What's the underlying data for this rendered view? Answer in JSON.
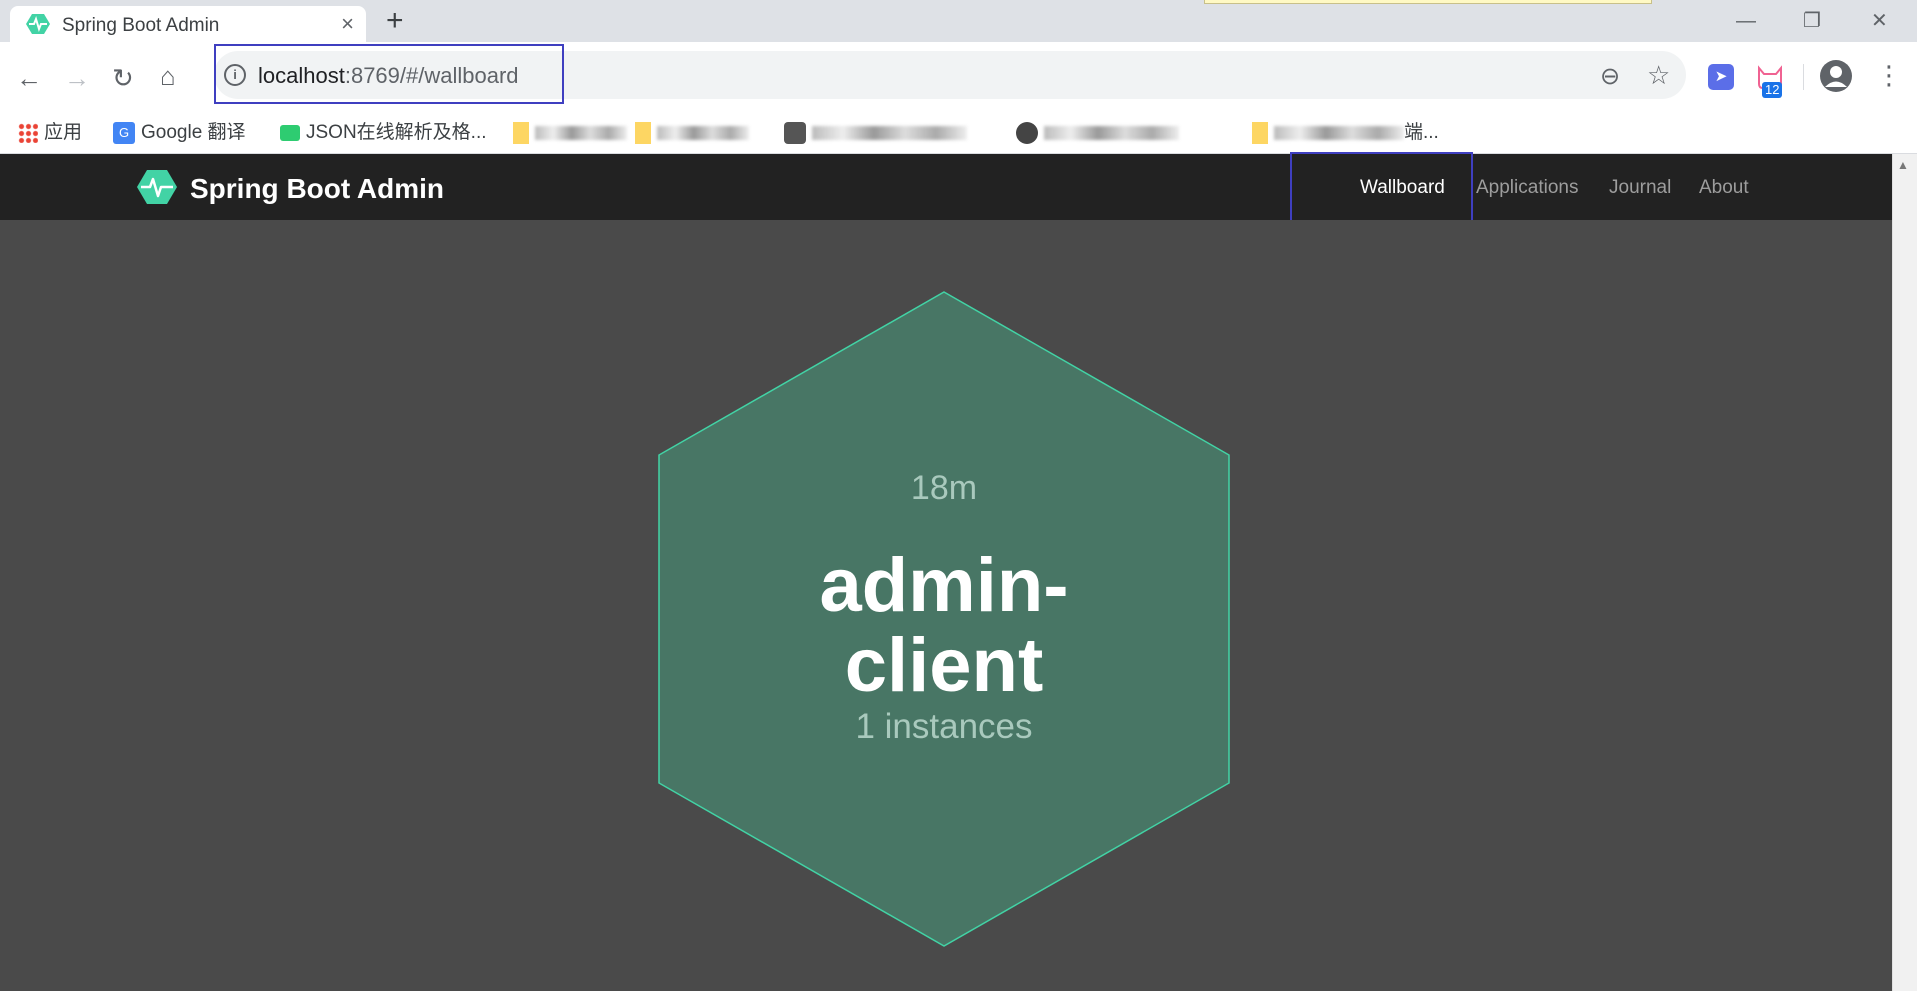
{
  "browser": {
    "tab": {
      "title": "Spring Boot Admin",
      "favicon": "spring-boot-admin-heart-icon"
    },
    "new_tab_label": "+",
    "window_controls": {
      "minimize": "—",
      "restore": "❐",
      "close": "✕"
    },
    "address": {
      "host": "localhost",
      "rest": ":8769/#/wallboard"
    },
    "extension_badge": "12",
    "bookmarks": [
      {
        "label": "应用",
        "icon": "apps-grid-icon"
      },
      {
        "label": "Google 翻译",
        "icon": "google-translate-icon"
      },
      {
        "label": "JSON在线解析及格...",
        "icon": "json-icon"
      },
      {
        "label": "",
        "icon": "folder-icon"
      },
      {
        "label": "",
        "icon": "folder-icon"
      },
      {
        "label": "",
        "icon": "site-icon"
      },
      {
        "label": "",
        "icon": "site-icon"
      },
      {
        "label": "端...",
        "icon": "folder-icon"
      }
    ],
    "colors": {
      "highlight_box": "#3f3fc0"
    }
  },
  "app": {
    "brand": "Spring Boot Admin",
    "nav": [
      {
        "label": "Wallboard",
        "active": true
      },
      {
        "label": "Applications",
        "active": false
      },
      {
        "label": "Journal",
        "active": false
      },
      {
        "label": "About",
        "active": false
      }
    ],
    "wallboard": {
      "application": {
        "uptime": "18m",
        "name": "admin-\nclient",
        "instances": "1 instances",
        "status": "UP"
      }
    },
    "colors": {
      "navbar": "#222222",
      "background": "#4a4a4a",
      "hex_fill": "#487665",
      "hex_stroke": "#42d3a5",
      "brand_logo": "#42d3a5"
    }
  }
}
